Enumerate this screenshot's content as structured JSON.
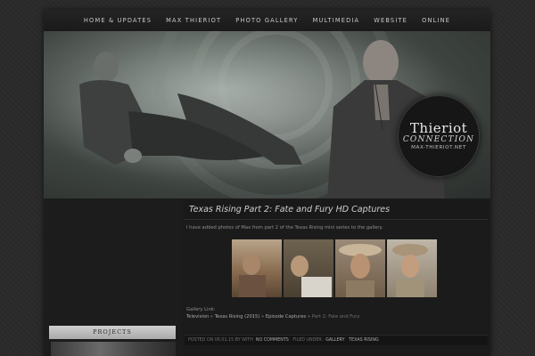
{
  "nav": {
    "items": [
      "Home & Updates",
      "Max Thieriot",
      "Photo Gallery",
      "Multimedia",
      "Website",
      "Online"
    ]
  },
  "logo": {
    "line1": "Thieriot",
    "line2": "CONNECTION",
    "line3": "MAX-THIERIOT.NET"
  },
  "sidebar": {
    "title": "PROJECTS"
  },
  "post": {
    "title": "Texas Rising Part 2: Fate and Fury HD Captures",
    "text": "I have added photos of Max from part 2 of the Texas Rising mini series to the gallery.",
    "gallery_label": "Gallery Link:",
    "breadcrumb": {
      "television": "Television",
      "texas_rising": "Texas Rising (2015)",
      "episode_captures": "Episode Captures",
      "current": "Part 2: Fate and Fury",
      "sep": " » "
    },
    "meta": {
      "posted": "POSTED ON 06.01.15 BY WITH",
      "comments": "NO COMMENTS",
      "filed": "FILED UNDER:",
      "cat1": "GALLERY",
      "cat2": "TEXAS RISING"
    }
  },
  "colors": {
    "page_bg": "#2a2a2a",
    "panel_bg": "#1b1b1b",
    "title_text": "#cfcfcf",
    "body_text": "#8f8f8f"
  }
}
